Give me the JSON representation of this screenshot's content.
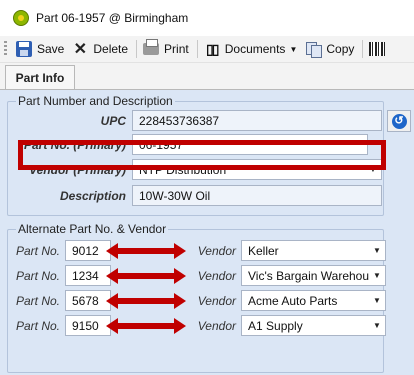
{
  "window": {
    "title": "Part 06-1957 @ Birmingham"
  },
  "toolbar": {
    "save_label": "Save",
    "delete_label": "Delete",
    "print_label": "Print",
    "documents_label": "Documents",
    "copy_label": "Copy"
  },
  "tabs": [
    {
      "label": "Part Info",
      "active": true
    }
  ],
  "part_section": {
    "legend": "Part Number and Description",
    "upc": {
      "label": "UPC",
      "value": "228453736387"
    },
    "part_no": {
      "label": "Part No. (Primary)",
      "value": "06-1957"
    },
    "vendor": {
      "label": "Vendor (Primary)",
      "value": "NTP Distribution"
    },
    "description": {
      "label": "Description",
      "value": "10W-30W Oil"
    }
  },
  "alternate_section": {
    "legend": "Alternate Part No. & Vendor",
    "part_label": "Part No.",
    "vendor_label": "Vendor",
    "rows": [
      {
        "part_no": "9012",
        "vendor": "Keller"
      },
      {
        "part_no": "1234",
        "vendor": "Vic's Bargain Warehouse"
      },
      {
        "part_no": "5678",
        "vendor": "Acme Auto Parts"
      },
      {
        "part_no": "9150",
        "vendor": "A1 Supply"
      }
    ]
  },
  "colors": {
    "highlight": "#c00000",
    "panel_bg": "#dbe6f5",
    "arrow": "#c00000"
  }
}
